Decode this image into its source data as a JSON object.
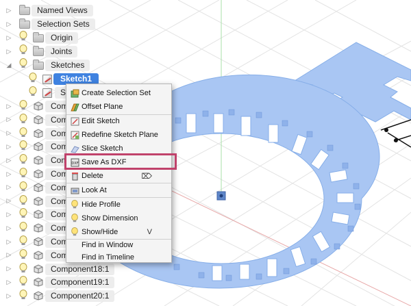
{
  "browser": {
    "items": [
      {
        "label": "Named Views"
      },
      {
        "label": "Selection Sets"
      },
      {
        "label": "Origin"
      },
      {
        "label": "Joints"
      },
      {
        "label": "Sketches"
      },
      {
        "label": "Sketch1"
      },
      {
        "label": "Sk"
      },
      {
        "label": "Comp"
      },
      {
        "label": "Comp"
      },
      {
        "label": "Comp"
      },
      {
        "label": "Comp"
      },
      {
        "label": "Comp"
      },
      {
        "label": "Comp"
      },
      {
        "label": "Comp"
      },
      {
        "label": "Comp"
      },
      {
        "label": "Comp"
      },
      {
        "label": "Comp"
      },
      {
        "label": "Comp"
      },
      {
        "label": "Comp"
      },
      {
        "label": "Component18:1"
      },
      {
        "label": "Component19:1"
      },
      {
        "label": "Component20:1"
      }
    ]
  },
  "context_menu": {
    "items": [
      {
        "label": "Create Selection Set",
        "icon": "selection-set-icon",
        "shortcut": ""
      },
      {
        "label": "Offset Plane",
        "icon": "offset-plane-icon",
        "shortcut": ""
      },
      {
        "label": "Edit Sketch",
        "icon": "edit-sketch-icon",
        "shortcut": ""
      },
      {
        "label": "Redefine Sketch Plane",
        "icon": "redefine-plane-icon",
        "shortcut": ""
      },
      {
        "label": "Slice Sketch",
        "icon": "slice-icon",
        "shortcut": ""
      },
      {
        "label": "Save As DXF",
        "icon": "dxf-icon",
        "shortcut": ""
      },
      {
        "label": "Delete",
        "icon": "delete-icon",
        "shortcut": "⌦"
      },
      {
        "label": "Look At",
        "icon": "look-at-icon",
        "shortcut": ""
      },
      {
        "label": "Hide Profile",
        "icon": "bulb-icon",
        "shortcut": ""
      },
      {
        "label": "Show Dimension",
        "icon": "bulb-icon",
        "shortcut": ""
      },
      {
        "label": "Show/Hide",
        "icon": "bulb-icon",
        "shortcut": "V"
      },
      {
        "label": "Find in Window",
        "icon": "",
        "shortcut": ""
      },
      {
        "label": "Find in Timeline",
        "icon": "",
        "shortcut": ""
      }
    ]
  },
  "colors": {
    "sketch_fill": "#a9c6f3",
    "selection_blue": "#3f82e0",
    "highlight": "#c0426b",
    "menu_bg": "#f4f4f4"
  }
}
